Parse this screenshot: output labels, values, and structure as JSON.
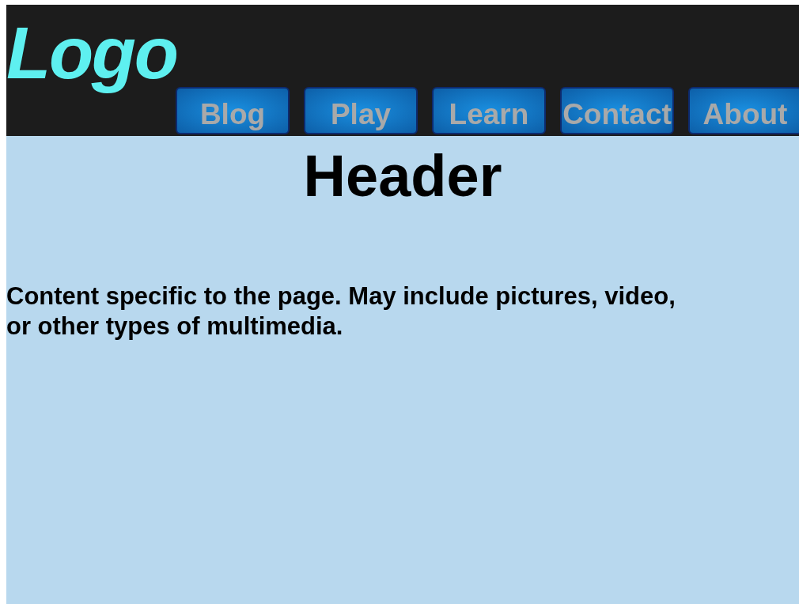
{
  "logo": "Logo",
  "nav": [
    {
      "label": "Blog"
    },
    {
      "label": "Play"
    },
    {
      "label": "Learn"
    },
    {
      "label": "Contact"
    },
    {
      "label": "About"
    }
  ],
  "header": "Header",
  "content": "Content specific to the page. May include pictures, video, or other types of multimedia."
}
